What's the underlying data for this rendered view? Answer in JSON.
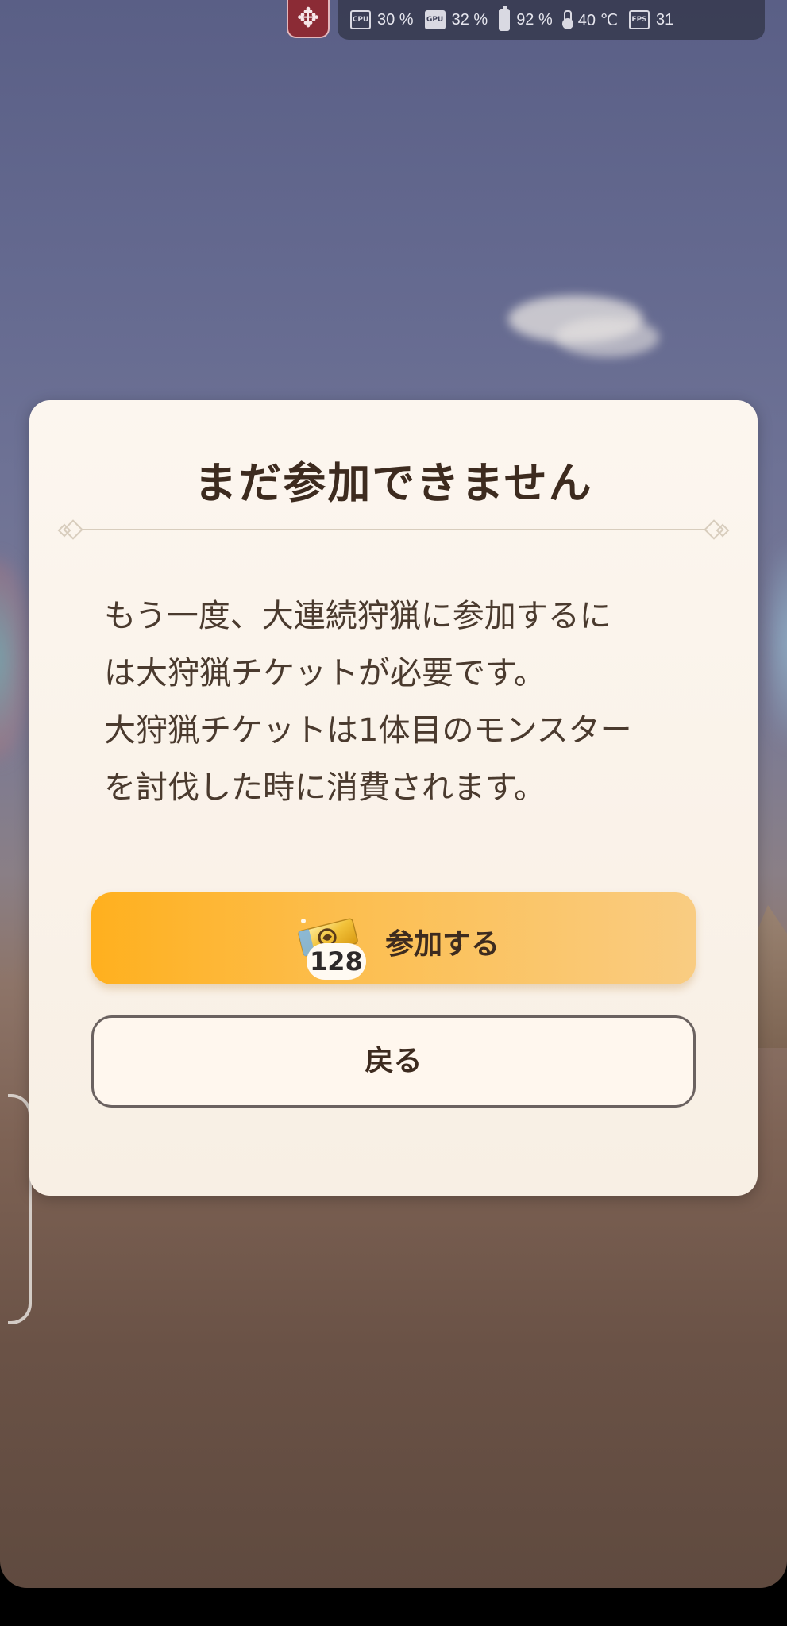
{
  "status_overlay": {
    "move_handle_icon": "move-arrows-icon",
    "cpu": {
      "label": "CPU",
      "value": "30 %"
    },
    "gpu": {
      "label": "GPU",
      "value": "32 %"
    },
    "battery": {
      "icon": "battery-icon",
      "value": "92 %"
    },
    "temperature": {
      "icon": "thermometer-icon",
      "value": "40 ℃"
    },
    "fps": {
      "label": "FPS",
      "value": "31"
    }
  },
  "dialog": {
    "title": "まだ参加できません",
    "message_lines": [
      "もう一度、大連続狩猟に参加するに",
      "は大狩猟チケットが必要です。",
      "大狩猟チケットは1体目のモンスター",
      "を討伐した時に消費されます。"
    ],
    "join_button": {
      "label": "参加する",
      "ticket_icon": "hunt-ticket-icon",
      "ticket_count": "128"
    },
    "back_button": {
      "label": "戻る"
    }
  },
  "colors": {
    "dialog_bg": "#fcf6ef",
    "title_text": "#3d2b1f",
    "join_gradient_start": "#ffb01e",
    "join_gradient_end": "#f9cc82",
    "back_border": "#6b6260"
  }
}
